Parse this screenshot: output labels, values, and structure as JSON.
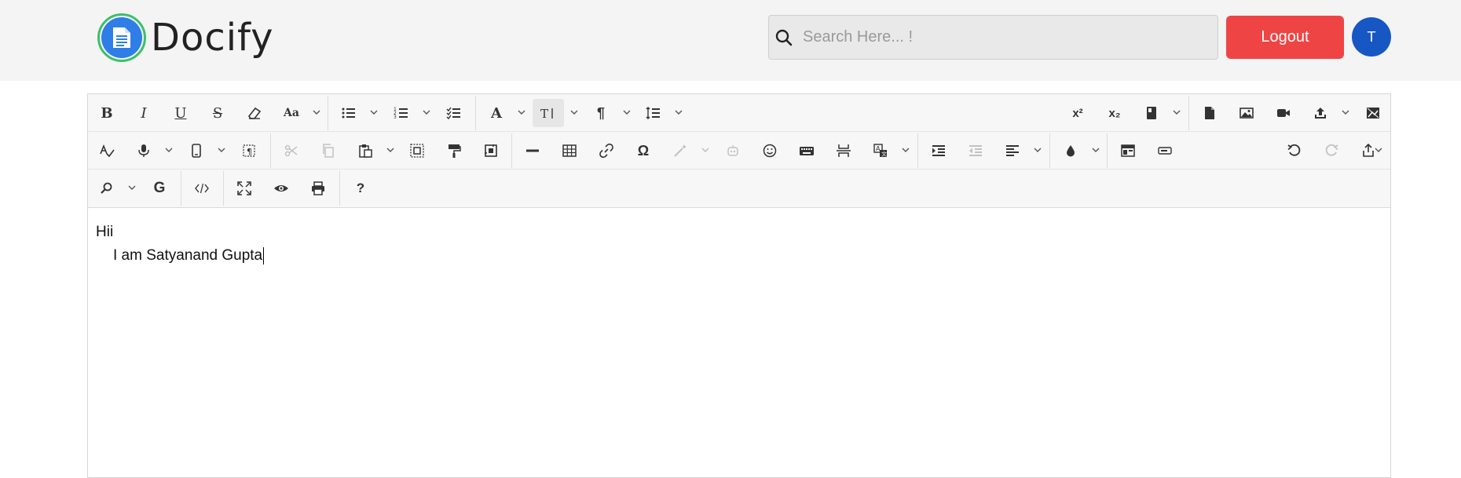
{
  "app": {
    "name": "Docify"
  },
  "search": {
    "placeholder": "Search Here... !",
    "value": ""
  },
  "header": {
    "logout_label": "Logout",
    "avatar_initial": "T"
  },
  "editor": {
    "lines": [
      "Hii",
      "I am Satyanand Gupta"
    ]
  },
  "colors": {
    "logout": "#ef4444",
    "avatar": "#1657c4",
    "logo_ring": "#3cc06a",
    "logo_fill": "#2f7ee8"
  },
  "toolbar": {
    "bold": "B",
    "italic": "I",
    "underline": "U",
    "strike": "S",
    "font_size_glyph": "Aa",
    "font_family_glyph": "A",
    "special_char": "Ω",
    "grammar": "G",
    "help": "?",
    "superscript": "x²",
    "subscript": "x₂",
    "paragraph": "¶"
  }
}
